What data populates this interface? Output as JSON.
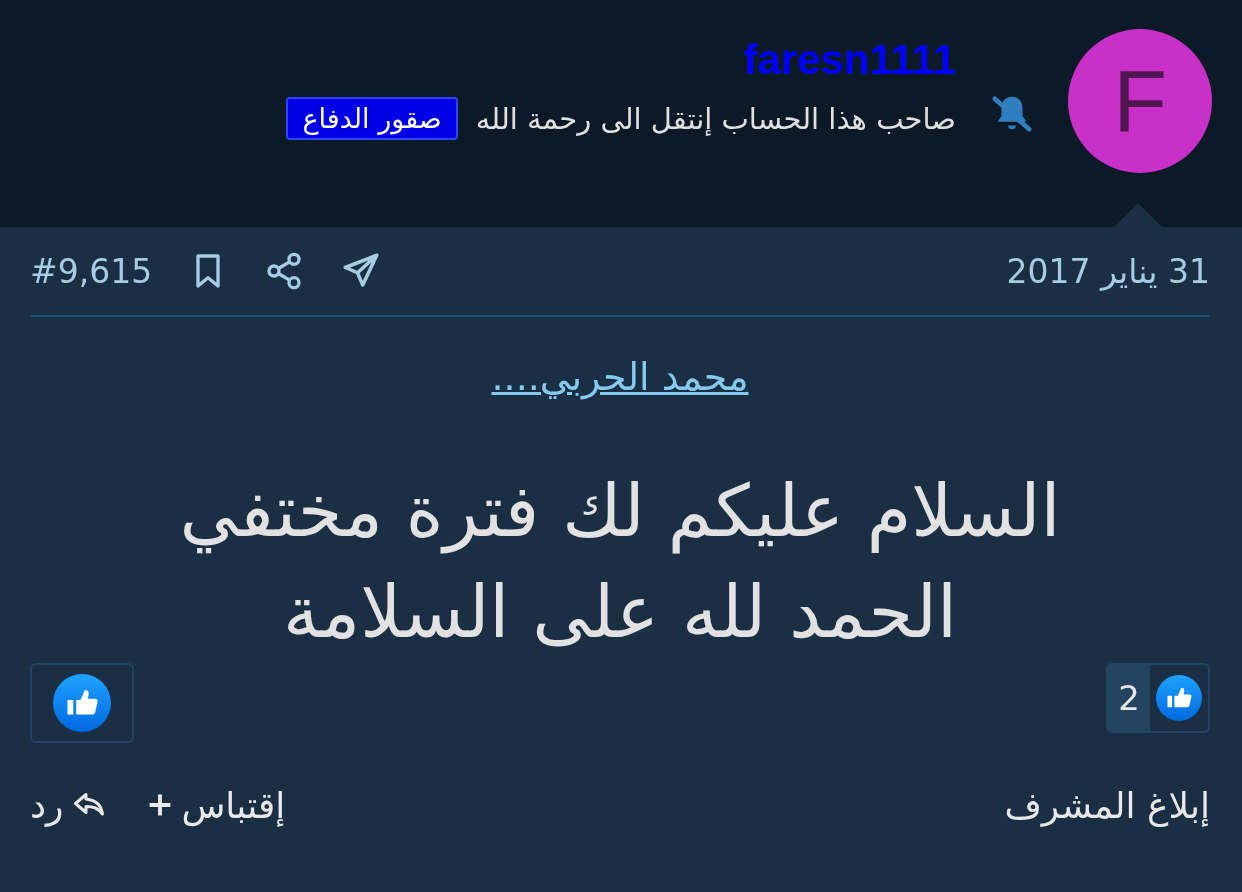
{
  "author": {
    "avatar_letter": "F",
    "username": "faresn1111",
    "status": "صاحب هذا الحساب إنتقل الى رحمة الله",
    "tag": "صقور الدفاع",
    "notifications_muted": true
  },
  "post": {
    "date": "31 يناير 2017",
    "number": "#9,615",
    "quote_link": "محمد الحربي....",
    "lines": [
      "السلام عليكم لك فترة مختفي",
      "الحمد لله على السلامة"
    ],
    "reactions": {
      "count": "2"
    },
    "actions": [
      {
        "kind": "report",
        "label": "إبلاغ المشرف"
      },
      {
        "kind": "quote",
        "label": "إقتباس"
      },
      {
        "kind": "reply",
        "label": "رد"
      }
    ]
  }
}
